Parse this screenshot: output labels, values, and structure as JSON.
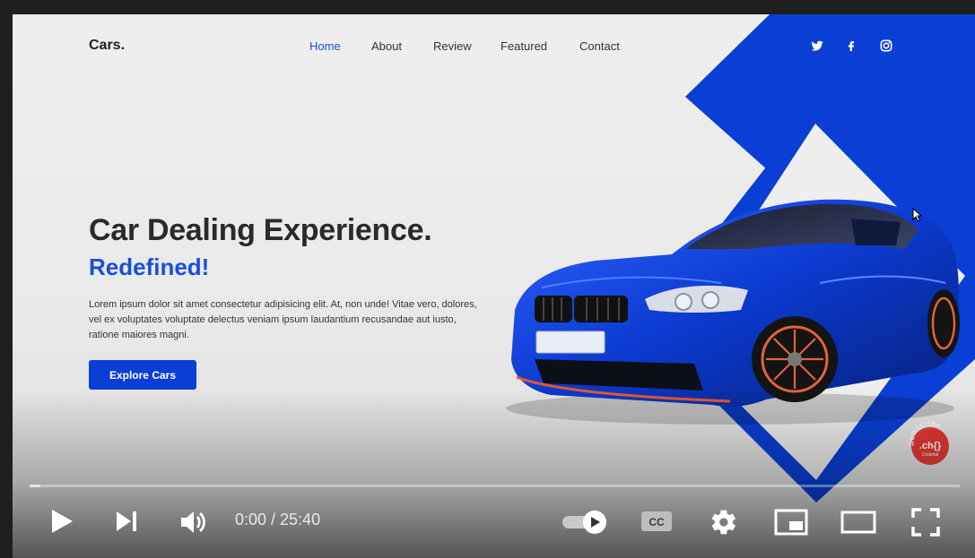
{
  "site": {
    "brand": "Cars.",
    "nav": [
      "Home",
      "About",
      "Review",
      "Featured",
      "Contact"
    ],
    "active_nav": "Home",
    "social": [
      "twitter-icon",
      "facebook-icon",
      "instagram-icon"
    ],
    "hero": {
      "title": "Car Dealing Experience.",
      "subtitle": "Redefined!",
      "text": "Lorem ipsum dolor sit amet consectetur adipisicing elit. At, non unde! Vitae vero, dolores, vel ex voluptates voluptate delectus veniam ipsum laudantium recusandae aut iusto, ratione maiores magni.",
      "cta": "Explore Cars"
    },
    "accent_color": "#0a3fd6"
  },
  "watermark": {
    "arc_text": "Subscribe",
    "logo": ".ch{}",
    "name": "Codehal"
  },
  "player": {
    "time_display": "0:00 / 25:40",
    "progress_fraction": 0.0,
    "controls": {
      "left": [
        "play-icon",
        "next-icon",
        "volume-icon"
      ],
      "right": [
        "autoplay-toggle",
        "captions-icon",
        "settings-icon",
        "miniplayer-icon",
        "theater-icon",
        "fullscreen-icon"
      ]
    },
    "captions_label": "CC"
  }
}
